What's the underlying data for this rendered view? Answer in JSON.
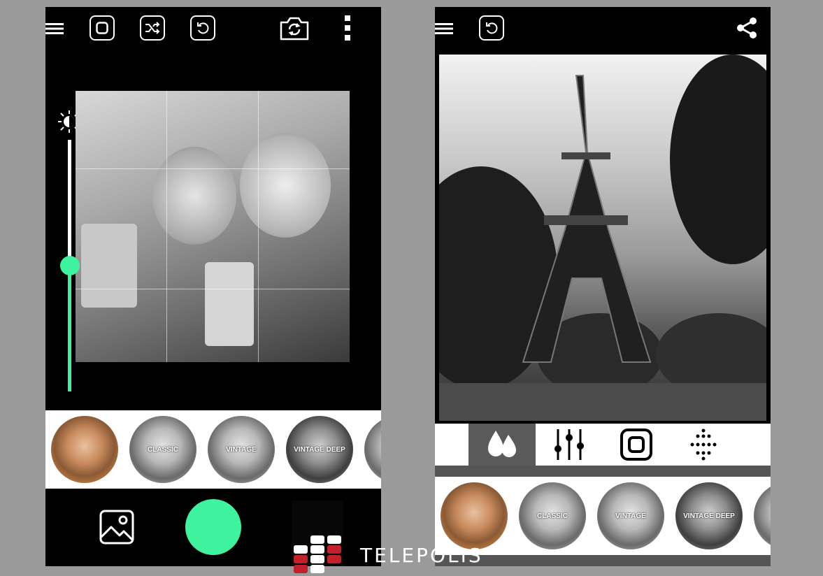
{
  "left_screen": {
    "toolbar": {
      "menu_icon": "hamburger-menu-icon",
      "square_icon": "square-frame-icon",
      "shuffle_icon": "shuffle-icon",
      "reset_icon": "undo-icon",
      "camera_switch_icon": "camera-switch-icon",
      "more_icon": "more-vertical-icon"
    },
    "brightness": {
      "icon": "brightness-sun-icon",
      "level": 0.5
    },
    "filters": [
      {
        "label": "",
        "style": "color"
      },
      {
        "label": "CLASSIC",
        "style": "gray"
      },
      {
        "label": "VINTAGE",
        "style": "gray"
      },
      {
        "label": "VINTAGE DEEP",
        "style": "dark"
      }
    ],
    "controls": {
      "gallery_icon": "image-gallery-icon",
      "shutter_color": "#3ef29e"
    }
  },
  "right_screen": {
    "toolbar": {
      "menu_icon": "hamburger-menu-icon",
      "reset_icon": "undo-icon",
      "share_icon": "share-icon"
    },
    "tools": [
      {
        "icon": "drops-icon",
        "active": true
      },
      {
        "icon": "sliders-icon",
        "active": false
      },
      {
        "icon": "square-frame-icon",
        "active": false
      },
      {
        "icon": "dots-grid-icon",
        "active": false
      }
    ],
    "filters": [
      {
        "label": "",
        "style": "color"
      },
      {
        "label": "CLASSIC",
        "style": "gray"
      },
      {
        "label": "VINTAGE",
        "style": "gray"
      },
      {
        "label": "VINTAGE DEEP",
        "style": "dark"
      }
    ]
  },
  "watermark": {
    "text": "TELEPOLIS"
  },
  "colors": {
    "accent": "#3ef29e",
    "watermark_red": "#c4202b",
    "background": "#9a9a9a"
  }
}
